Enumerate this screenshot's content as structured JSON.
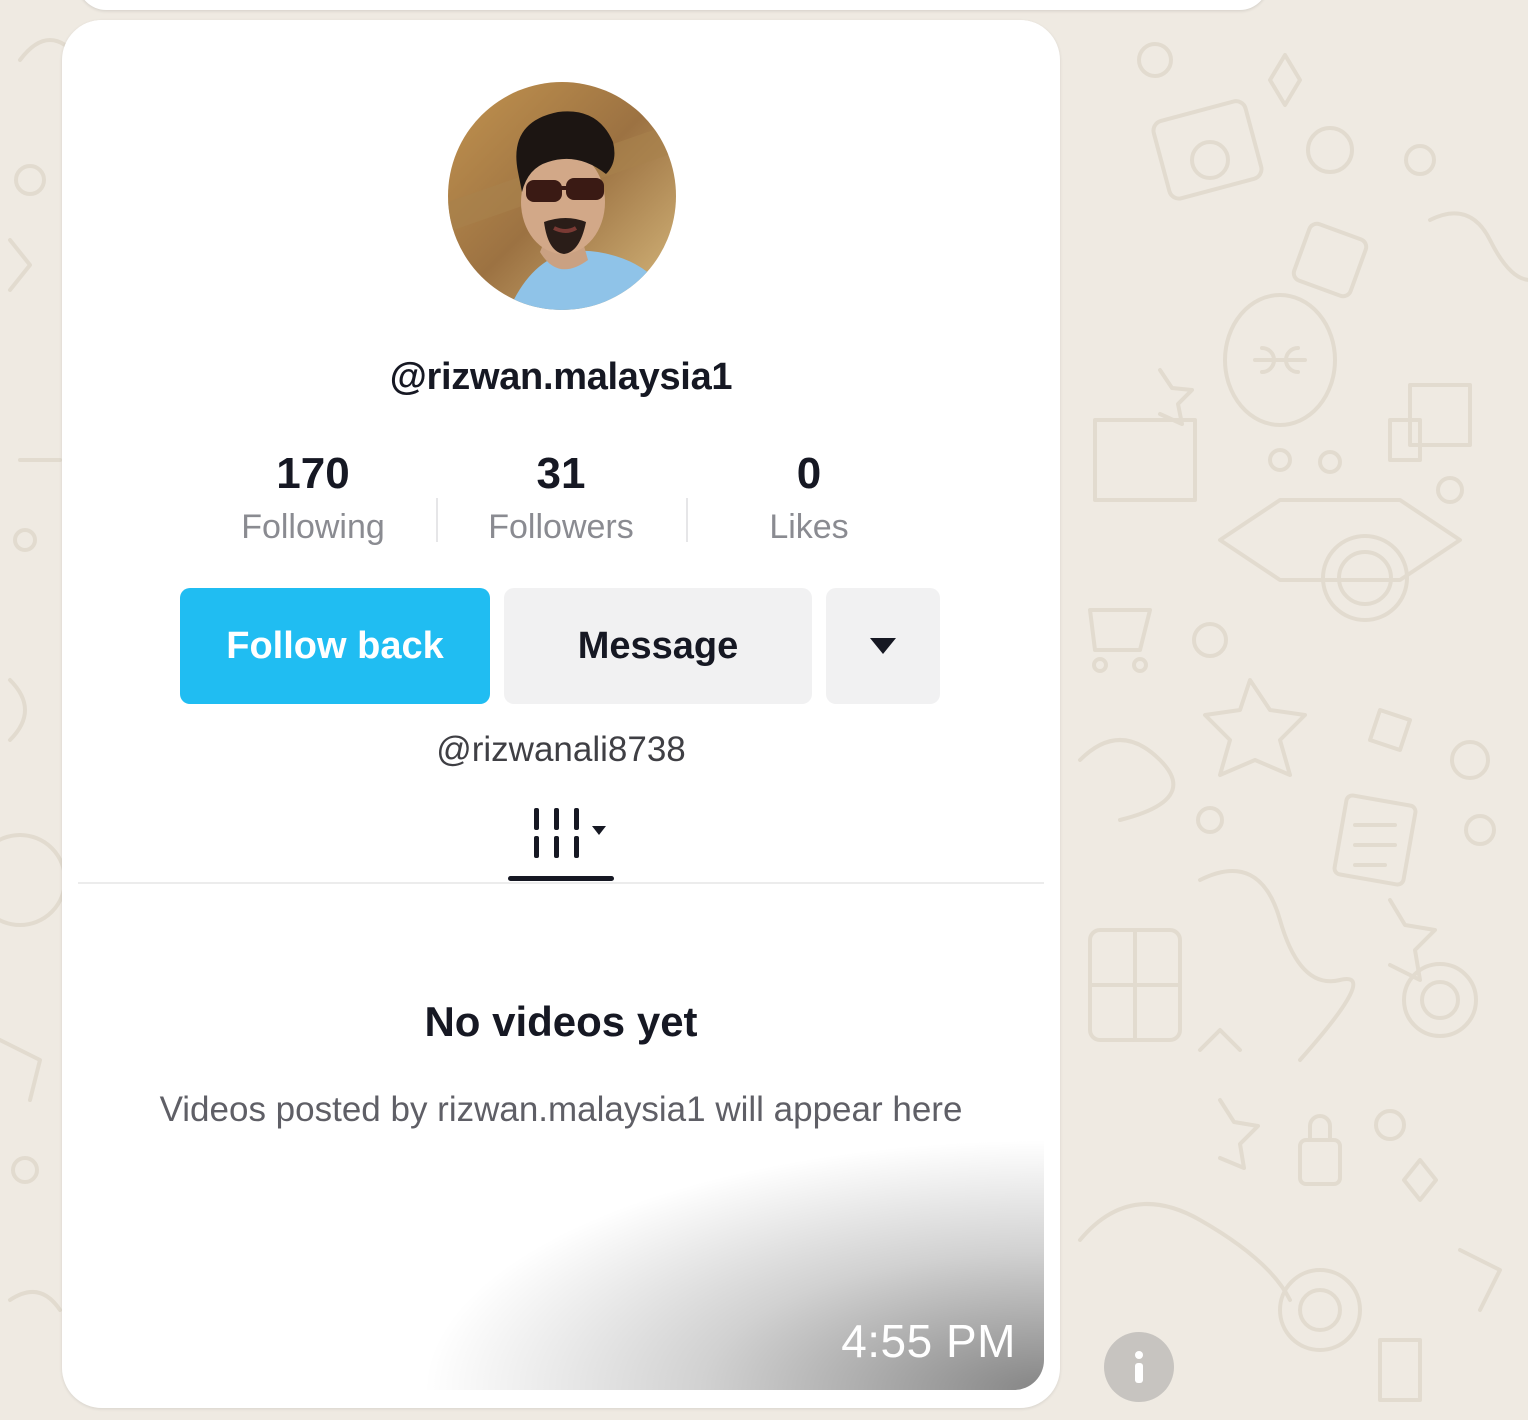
{
  "profile": {
    "username": "@rizwan.malaysia1",
    "secondary_handle": "@rizwanali8738",
    "avatar_icon": "profile-photo"
  },
  "stats": [
    {
      "value": "170",
      "label": "Following"
    },
    {
      "value": "31",
      "label": "Followers"
    },
    {
      "value": "0",
      "label": "Likes"
    }
  ],
  "buttons": {
    "follow_back": "Follow back",
    "message": "Message",
    "more_icon": "caret-down-icon"
  },
  "tabs": {
    "videos_icon": "grid-icon"
  },
  "empty_state": {
    "title": "No videos yet",
    "description": "Videos posted by rizwan.malaysia1 will appear here"
  },
  "message": {
    "timestamp": "4:55 PM"
  },
  "colors": {
    "accent": "#20bdf2",
    "chat_background": "#efeae2",
    "bubble": "#ffffff"
  }
}
